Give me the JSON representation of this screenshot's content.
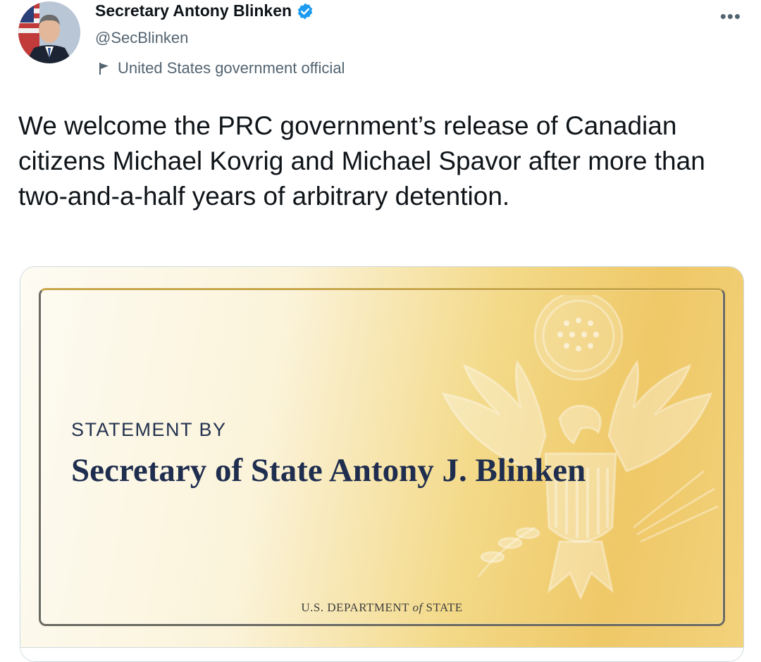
{
  "author": {
    "display_name": "Secretary Antony Blinken",
    "handle": "@SecBlinken",
    "label": "United States government official",
    "avatar": "avatar-photo",
    "verified": true
  },
  "icons": {
    "verified": "verified-badge-icon",
    "label": "flag-icon",
    "more": "more-options-icon"
  },
  "more_glyph": "•••",
  "tweet": {
    "text": "We welcome the PRC government’s release of Canadian citizens Michael Kovrig and Michael Spavor after more than two-and-a-half years of arbitrary detention."
  },
  "card": {
    "statement_by": "STATEMENT BY",
    "title": "Secretary of State Antony J. Blinken",
    "dept_prefix": "U.S. DEPARTMENT ",
    "dept_of": "of",
    "dept_suffix": " STATE"
  },
  "colors": {
    "accent": "#1d9bf0",
    "text_primary": "#0f1419",
    "text_secondary": "#536471",
    "card_title": "#1f2d4f",
    "card_gold": "#efc867"
  }
}
